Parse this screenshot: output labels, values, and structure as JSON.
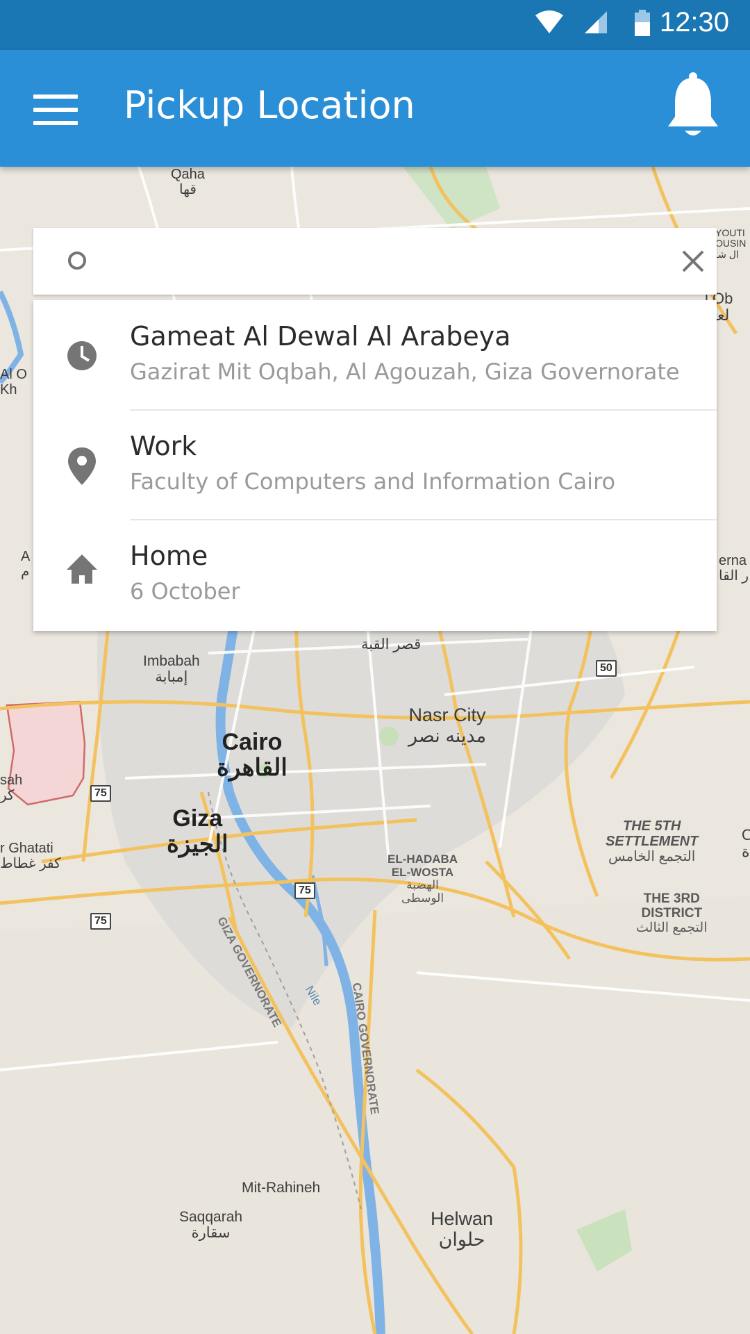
{
  "status_bar": {
    "time": "12:30"
  },
  "app_bar": {
    "title": "Pickup Location"
  },
  "search": {
    "value": "",
    "placeholder": ""
  },
  "suggestions": [
    {
      "icon": "clock-icon",
      "title": "Gameat Al Dewal Al Arabeya",
      "subtitle": "Gazirat Mit Oqbah, Al Agouzah, Giza Governorate"
    },
    {
      "icon": "location-pin-icon",
      "title": "Work",
      "subtitle": "Faculty of Computers and Information Cairo"
    },
    {
      "icon": "home-icon",
      "title": "Home",
      "subtitle": "6 October"
    }
  ],
  "map": {
    "labels": {
      "qaha": "Qaha",
      "qaha_ar": "قها",
      "imbabah": "Imbabah",
      "imbabah_ar": "إمبابة",
      "qasr": "قصر القبة",
      "nasr_city": "Nasr City",
      "nasr_city_ar": "مدينه نصر",
      "cairo": "Cairo",
      "cairo_ar": "القاهرة",
      "giza": "Giza",
      "giza_ar": "الجيزة",
      "kafr_ghatati": "r Ghatati",
      "kafr_ghatati_ar": "كفر غطاط",
      "sah": "sah",
      "sah_ar": "كر",
      "fifth_settlement_1": "THE 5TH",
      "fifth_settlement_2": "SETTLEMENT",
      "fifth_settlement_ar": "التجمع الخامس",
      "third_district_1": "THE 3RD",
      "third_district_2": "DISTRICT",
      "third_district_ar": "التجمع الثالث",
      "hadaba_1": "EL-HADABA",
      "hadaba_2": "EL-WOSTA",
      "hadaba_ar1": "الهضبة",
      "hadaba_ar2": "الوسطى",
      "giza_gov": "GIZA GOVERNORATE",
      "cairo_gov": "CAIRO GOVERNORATE",
      "nile": "Nile",
      "mit_rahineh": "Mit-Rahineh",
      "saqqarah": "Saqqarah",
      "saqqarah_ar": "سقارة",
      "helwan": "Helwan",
      "helwan_ar": "حلوان",
      "al_left": "Al O",
      "kh_left": "Kh",
      "a_left": "A",
      "m_left": "م",
      "youth_1": "YOUTI",
      "youth_2": "OUSIN",
      "youth_3": "ال شـ",
      "ob": "l Ob",
      "ob_ar": "لعبو",
      "erna": "erna",
      "erna_ar": "ر القا",
      "o_right": "O",
      "o_right_ar": "ة"
    },
    "shields": {
      "r50": "50",
      "r75a": "75",
      "r75b": "75",
      "r75c": "75"
    }
  }
}
